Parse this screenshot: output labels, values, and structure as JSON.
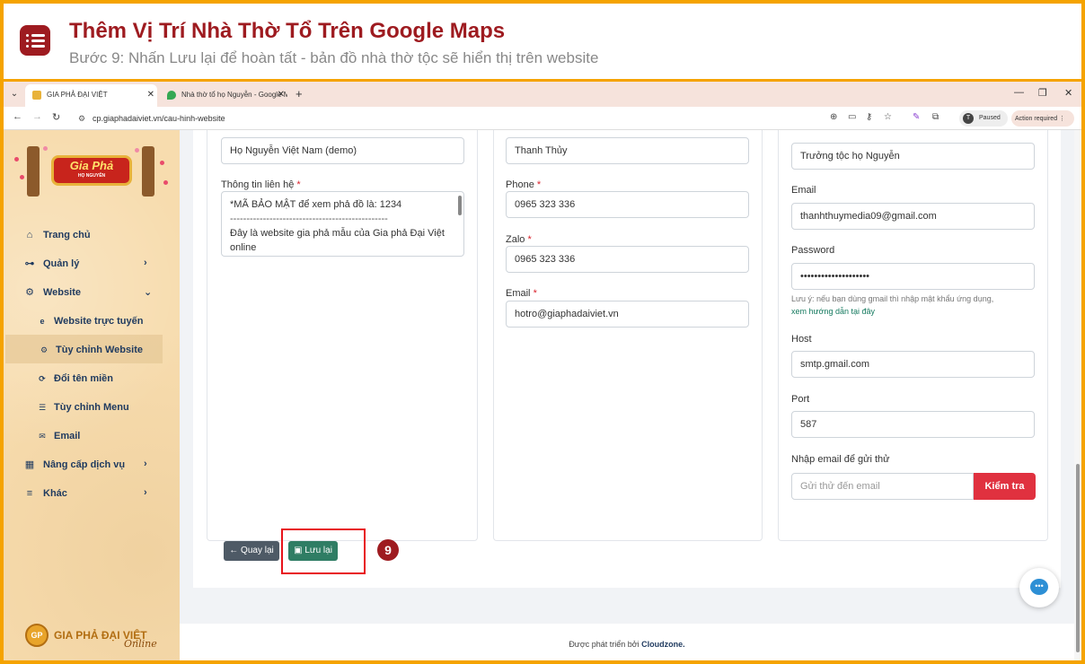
{
  "tutorial": {
    "title": "Thêm Vị Trí Nhà Thờ Tổ Trên Google Maps",
    "subtitle": "Bước 9: Nhấn Lưu lại để hoàn tất - bản đồ nhà thờ tộc sẽ hiển thị trên website",
    "step_number": "9",
    "accent_color": "#9e1b20",
    "frame_color": "#f5a300"
  },
  "browser": {
    "tabs": [
      {
        "label": "GIA PHẢ ĐẠI VIỆT",
        "close": "✕"
      },
      {
        "label": "Nhà thờ tổ họ Nguyễn - Google Maps",
        "close": "✕"
      }
    ],
    "new_tab": "+",
    "url": "cp.giaphadaiviet.vn/cau-hinh-website",
    "profile_initial": "T",
    "profile_status": "Paused",
    "action_required": "Action required"
  },
  "sidebar": {
    "logo_title": "Gia Phả",
    "logo_sub": "HỌ NGUYỄN",
    "items": [
      {
        "label": "Trang chủ",
        "icon": "home-icon"
      },
      {
        "label": "Quản lý",
        "icon": "sitemap-icon"
      },
      {
        "label": "Website",
        "icon": "gear-icon"
      },
      {
        "label": "Website trực tuyến",
        "icon": "globe-icon"
      },
      {
        "label": "Tùy chỉnh Website",
        "icon": "gear-icon"
      },
      {
        "label": "Đổi tên miền",
        "icon": "refresh-icon"
      },
      {
        "label": "Tùy chỉnh Menu",
        "icon": "list-icon"
      },
      {
        "label": "Email",
        "icon": "envelope-icon"
      },
      {
        "label": "Nâng cấp dịch vụ",
        "icon": "chart-icon"
      },
      {
        "label": "Khác",
        "icon": "bars-icon"
      }
    ],
    "footer_logo_mark": "GP",
    "footer_logo_text": "GIA PHẢ ĐẠI VIỆT",
    "footer_logo_script": "Online"
  },
  "form": {
    "col1": {
      "name_value": "Họ Nguyễn Việt Nam (demo)",
      "contact_label": "Thông tin liên hệ",
      "contact_lines": [
        "*MÃ BẢO MẬT để xem phả đồ là: 1234",
        "------------------------------------------------",
        "Đây là website gia phả mẫu của Gia phả Đại Việt online"
      ]
    },
    "col2": {
      "name_value": "Thanh Thủy",
      "phone_label": "Phone",
      "phone_value": "0965 323 336",
      "zalo_label": "Zalo",
      "zalo_value": "0965 323 336",
      "email_label": "Email",
      "email_value": "hotro@giaphadaiviet.vn"
    },
    "col3": {
      "title_value": "Trưởng tộc họ Nguyễn",
      "email_label": "Email",
      "email_value": "thanhthuymedia09@gmail.com",
      "password_label": "Password",
      "password_value": "••••••••••••••••••••",
      "note": "Lưu ý: nếu bạn dùng gmail thì nhập mật khẩu ứng dụng,",
      "note_link": "xem hướng dẫn tại đây",
      "host_label": "Host",
      "host_value": "smtp.gmail.com",
      "port_label": "Port",
      "port_value": "587",
      "test_label": "Nhập email để gửi thử",
      "test_placeholder": "Gửi thử đến email",
      "test_button": "Kiểm tra"
    },
    "required_mark": "*",
    "back_button": "Quay lại",
    "save_button": "Lưu lại"
  },
  "footer": {
    "text": "Được phát triển bởi ",
    "brand": "Cloudzone."
  }
}
